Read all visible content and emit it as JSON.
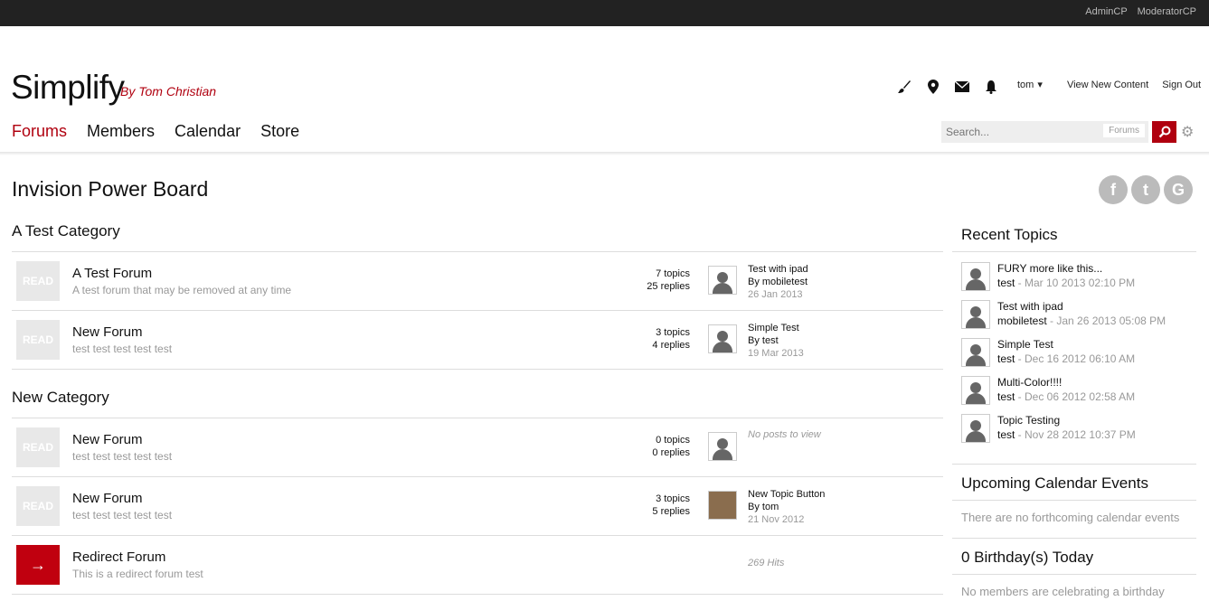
{
  "topbar": {
    "admin_cp": "AdminCP",
    "moderator_cp": "ModeratorCP"
  },
  "brand": {
    "logo": "Simplify",
    "byline": "By Tom Christian",
    "accent_color": "#b0000f"
  },
  "user_bar": {
    "username": "tom",
    "view_new": "View New Content",
    "sign_out": "Sign Out",
    "icons": [
      "brush-icon",
      "map-pin-icon",
      "mail-icon",
      "bell-icon"
    ]
  },
  "nav": {
    "tabs": [
      "Forums",
      "Members",
      "Calendar",
      "Store"
    ],
    "active": "Forums"
  },
  "search": {
    "placeholder": "Search...",
    "scope": "Forums"
  },
  "board_title": "Invision Power Board",
  "social": [
    "f",
    "t",
    "G"
  ],
  "categories": [
    {
      "title": "A Test Category",
      "forums": [
        {
          "badge": "READ",
          "name": "A Test Forum",
          "desc": "A test forum that may be removed at any time",
          "topics": "7 topics",
          "replies": "25 replies",
          "last_title": "Test with ipad",
          "last_by": "By mobiletest",
          "last_date": "26 Jan 2013"
        },
        {
          "badge": "READ",
          "name": "New Forum",
          "desc": "test test test test test",
          "topics": "3 topics",
          "replies": "4 replies",
          "last_title": "Simple Test",
          "last_by": "By test",
          "last_date": "19 Mar 2013"
        }
      ]
    },
    {
      "title": "New Category",
      "forums": [
        {
          "badge": "READ",
          "name": "New Forum",
          "desc": "test test test test test",
          "topics": "0 topics",
          "replies": "0 replies",
          "no_posts": "No posts to view"
        },
        {
          "badge": "READ",
          "name": "New Forum",
          "desc": "test test test test test",
          "topics": "3 topics",
          "replies": "5 replies",
          "last_title": "New Topic Button",
          "last_by": "By tom",
          "last_date": "21 Nov 2012"
        },
        {
          "badge": "→",
          "name": "Redirect Forum",
          "desc": "This is a redirect forum test",
          "hits": "269 Hits"
        }
      ]
    }
  ],
  "sidebar": {
    "recent_topics_title": "Recent Topics",
    "recent_topics": [
      {
        "title": "FURY more like this...",
        "user": "test",
        "date": " - Mar 10 2013 02:10 PM"
      },
      {
        "title": "Test with ipad",
        "user": "mobiletest",
        "date": " - Jan 26 2013 05:08 PM"
      },
      {
        "title": "Simple Test",
        "user": "test",
        "date": " - Dec 16 2012 06:10 AM"
      },
      {
        "title": "Multi-Color!!!!",
        "user": "test",
        "date": " - Dec 06 2012 02:58 AM"
      },
      {
        "title": "Topic Testing",
        "user": "test",
        "date": " - Nov 28 2012 10:37 PM"
      }
    ],
    "events_title": "Upcoming Calendar Events",
    "events_text": "There are no forthcoming calendar events",
    "birthdays_title": "0 Birthday(s) Today",
    "birthdays_text": "No members are celebrating a birthday"
  }
}
